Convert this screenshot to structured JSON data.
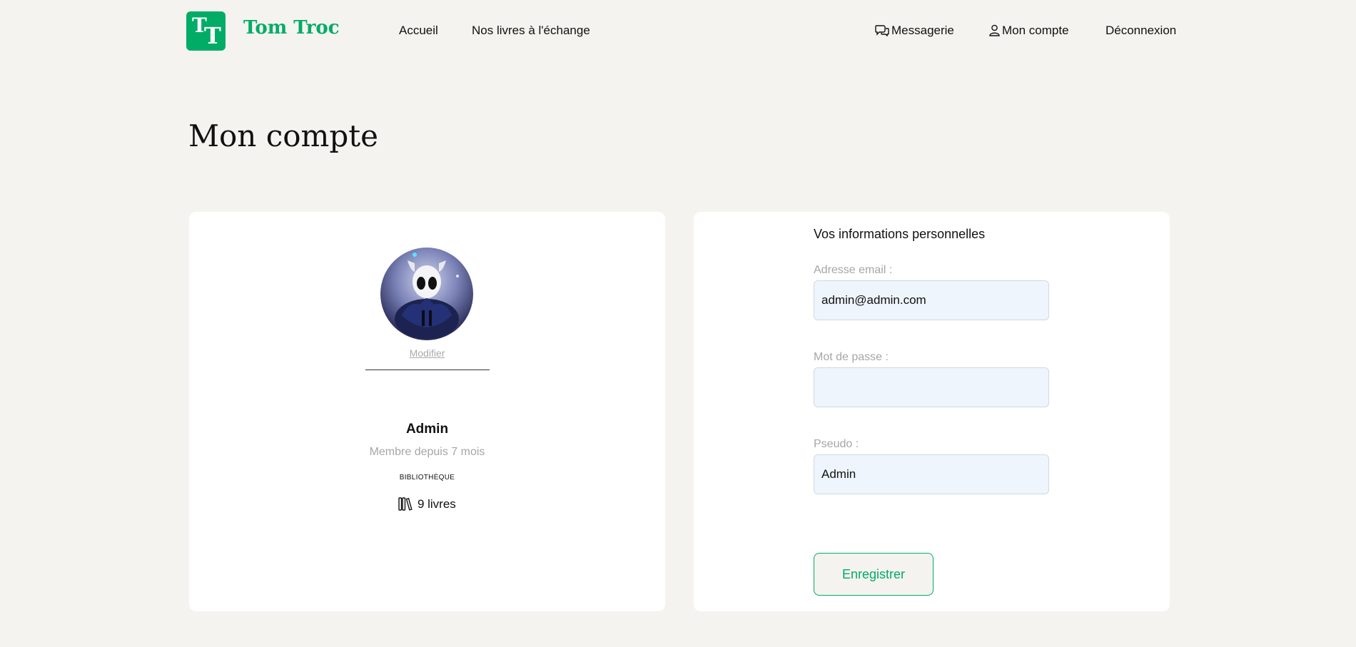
{
  "brand": {
    "initials_1": "T",
    "initials_2": "T",
    "name": "Tom Troc",
    "color": "#00ac66"
  },
  "nav": {
    "home": "Accueil",
    "books": "Nos livres à l'échange",
    "messages": "Messagerie",
    "account": "Mon compte",
    "logout": "Déconnexion"
  },
  "page": {
    "title": "Mon compte"
  },
  "profile": {
    "modify_label": "Modifier",
    "name": "Admin",
    "member_since": "Membre depuis 7 mois",
    "library_label": "BIBLIOTHÈQUE",
    "books_count": "9 livres"
  },
  "form": {
    "title": "Vos informations personnelles",
    "email_label": "Adresse email :",
    "email_value": "admin@admin.com",
    "password_label": "Mot de passe :",
    "password_value": "",
    "pseudo_label": "Pseudo :",
    "pseudo_value": "Admin",
    "save_label": "Enregistrer"
  },
  "icons": {
    "messages": "chat-bubbles-icon",
    "account": "user-icon",
    "books": "books-icon"
  }
}
